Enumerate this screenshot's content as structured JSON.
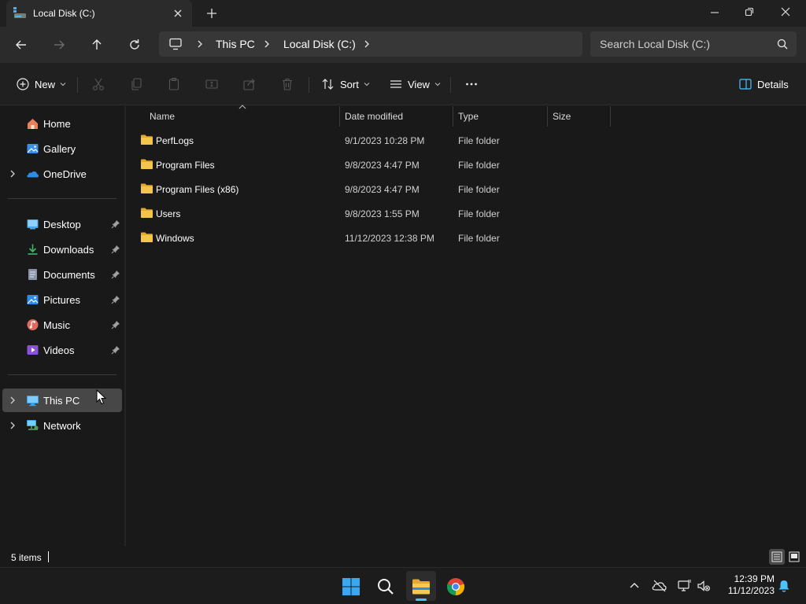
{
  "window": {
    "tab_title": "Local Disk (C:)",
    "icons": {
      "tab": "drive-icon",
      "close_tab": "close-icon",
      "new_tab": "plus-icon",
      "minimize": "minimize-icon",
      "restore": "restore-icon",
      "close": "close-icon"
    }
  },
  "address_bar": {
    "breadcrumbs": [
      "This PC",
      "Local Disk (C:)"
    ],
    "search_placeholder": "Search Local Disk (C:)"
  },
  "toolbar": {
    "new_label": "New",
    "sort_label": "Sort",
    "view_label": "View",
    "details_label": "Details",
    "disabled_actions": [
      "cut",
      "copy",
      "paste",
      "rename",
      "share",
      "delete"
    ]
  },
  "sidebar": {
    "top": [
      {
        "label": "Home",
        "icon": "home-icon",
        "expandable": false
      },
      {
        "label": "Gallery",
        "icon": "gallery-icon",
        "expandable": false
      },
      {
        "label": "OneDrive",
        "icon": "cloud-icon",
        "expandable": true
      }
    ],
    "quick_access": [
      {
        "label": "Desktop",
        "icon": "desktop-icon",
        "pinned": true
      },
      {
        "label": "Downloads",
        "icon": "download-icon",
        "pinned": true
      },
      {
        "label": "Documents",
        "icon": "document-icon",
        "pinned": true
      },
      {
        "label": "Pictures",
        "icon": "pictures-icon",
        "pinned": true
      },
      {
        "label": "Music",
        "icon": "music-icon",
        "pinned": true
      },
      {
        "label": "Videos",
        "icon": "videos-icon",
        "pinned": true
      }
    ],
    "locations": [
      {
        "label": "This PC",
        "icon": "pc-icon",
        "selected": true
      },
      {
        "label": "Network",
        "icon": "network-icon",
        "selected": false
      }
    ]
  },
  "file_list": {
    "columns": [
      "Name",
      "Date modified",
      "Type",
      "Size"
    ],
    "sort_column": "Name",
    "rows": [
      {
        "name": "PerfLogs",
        "date": "9/1/2023 10:28 PM",
        "type": "File folder",
        "size": ""
      },
      {
        "name": "Program Files",
        "date": "9/8/2023 4:47 PM",
        "type": "File folder",
        "size": ""
      },
      {
        "name": "Program Files (x86)",
        "date": "9/8/2023 4:47 PM",
        "type": "File folder",
        "size": ""
      },
      {
        "name": "Users",
        "date": "9/8/2023 1:55 PM",
        "type": "File folder",
        "size": ""
      },
      {
        "name": "Windows",
        "date": "11/12/2023 12:38 PM",
        "type": "File folder",
        "size": ""
      }
    ]
  },
  "status_bar": {
    "item_count": "5 items"
  },
  "taskbar": {
    "apps": [
      "start-icon",
      "search-icon",
      "file-explorer-icon",
      "chrome-icon"
    ],
    "active_app": "file-explorer-icon",
    "time": "12:39 PM",
    "date": "11/12/2023"
  },
  "colors": {
    "accent": "#4cc2ff",
    "folder": "#f4c54b",
    "selection": "#474747",
    "window_bg": "#191919"
  }
}
